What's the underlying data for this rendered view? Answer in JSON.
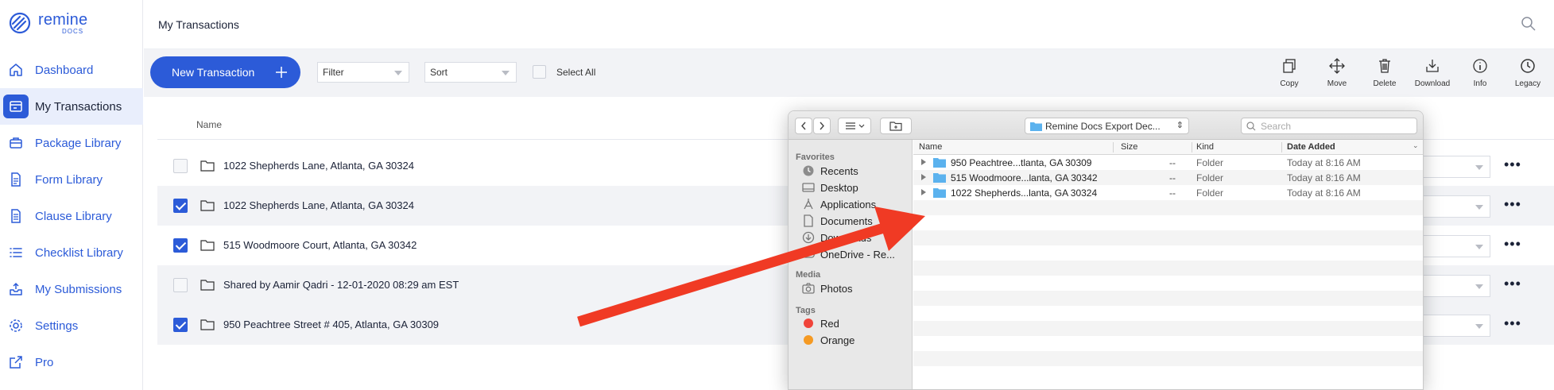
{
  "app": {
    "logo_name": "remine",
    "logo_sub": "DOCS",
    "brand_color": "#2c5bd8"
  },
  "sidebar": {
    "items": [
      {
        "label": "Dashboard",
        "icon": "home-icon"
      },
      {
        "label": "My Transactions",
        "icon": "transactions-icon",
        "active": true
      },
      {
        "label": "Package Library",
        "icon": "package-icon"
      },
      {
        "label": "Form Library",
        "icon": "form-icon"
      },
      {
        "label": "Clause Library",
        "icon": "clause-icon"
      },
      {
        "label": "Checklist Library",
        "icon": "checklist-icon"
      },
      {
        "label": "My Submissions",
        "icon": "submissions-icon"
      },
      {
        "label": "Settings",
        "icon": "gear-icon"
      },
      {
        "label": "Pro",
        "icon": "external-link-icon"
      }
    ]
  },
  "header": {
    "title": "My Transactions"
  },
  "toolbar": {
    "new_transaction": "New Transaction",
    "filter_placeholder": "Filter",
    "sort_placeholder": "Sort",
    "select_all": "Select All",
    "actions": [
      {
        "label": "Copy",
        "icon": "copy-icon"
      },
      {
        "label": "Move",
        "icon": "move-icon"
      },
      {
        "label": "Delete",
        "icon": "trash-icon"
      },
      {
        "label": "Download",
        "icon": "download-icon"
      },
      {
        "label": "Info",
        "icon": "info-icon"
      },
      {
        "label": "Legacy",
        "icon": "clock-icon"
      }
    ]
  },
  "list": {
    "column_name": "Name",
    "rows": [
      {
        "name": "1022 Shepherds Lane, Atlanta, GA 30324",
        "checked": false
      },
      {
        "name": "1022 Shepherds Lane, Atlanta, GA 30324",
        "checked": true
      },
      {
        "name": "515 Woodmoore Court, Atlanta, GA 30342",
        "checked": true
      },
      {
        "name": "Shared by Aamir Qadri - 12-01-2020 08:29 am EST",
        "checked": false
      },
      {
        "name": "950 Peachtree Street # 405, Atlanta, GA 30309",
        "checked": true
      }
    ]
  },
  "finder": {
    "path": "Remine Docs Export Dec...",
    "search_placeholder": "Search",
    "sidebar": {
      "favorites_label": "Favorites",
      "favorites": [
        "Recents",
        "Desktop",
        "Applications",
        "Documents",
        "Downloads",
        "OneDrive - Re..."
      ],
      "media_label": "Media",
      "media": [
        "Photos"
      ],
      "tags_label": "Tags",
      "tags": [
        {
          "label": "Red",
          "color": "#f0443a"
        },
        {
          "label": "Orange",
          "color": "#f59a23"
        }
      ]
    },
    "columns": {
      "name": "Name",
      "size": "Size",
      "kind": "Kind",
      "date": "Date Added"
    },
    "rows": [
      {
        "name": "950 Peachtree...tlanta, GA 30309",
        "size": "--",
        "kind": "Folder",
        "date": "Today at 8:16 AM"
      },
      {
        "name": "515 Woodmoore...lanta, GA 30342",
        "size": "--",
        "kind": "Folder",
        "date": "Today at 8:16 AM"
      },
      {
        "name": "1022 Shepherds...lanta, GA 30324",
        "size": "--",
        "kind": "Folder",
        "date": "Today at 8:16 AM"
      }
    ]
  },
  "annotation": {
    "arrow_color": "#f03a24"
  }
}
